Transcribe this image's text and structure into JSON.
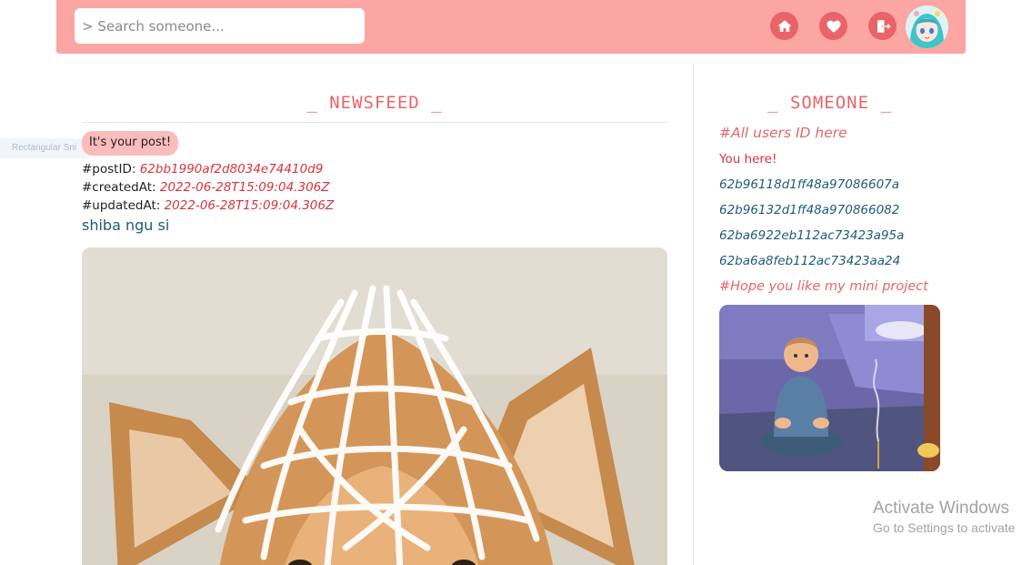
{
  "header": {
    "search_placeholder": "> Search someone...",
    "icons": [
      "home-icon",
      "heart-icon",
      "logout-icon"
    ],
    "accent": "#fba6a3",
    "icon_color": "#e8646a"
  },
  "ghost_tooltip": "Rectangular Sni",
  "newsfeed": {
    "title": "_ NEWSFEED _",
    "post": {
      "badge": "It's your post!",
      "post_id_label": "#postID:",
      "post_id": "62bb1990af2d8034e74410d9",
      "created_label": "#createdAt:",
      "created_at": "2022-06-28T15:09:04.306Z",
      "updated_label": "#updatedAt:",
      "updated_at": "2022-06-28T15:09:04.306Z",
      "caption": "shiba ngu si"
    }
  },
  "someone": {
    "title": "_ SOMEONE _",
    "all_users_label": "#All users ID here",
    "you_here": "You here!",
    "user_ids": [
      "62b96118d1ff48a97086607a",
      "62b96132d1ff48a970866082",
      "62ba6922eb112ac73423a95a",
      "62ba6a8feb112ac73423aa24"
    ],
    "hope_label": "#Hope you like my mini project"
  },
  "os_watermark": {
    "line1": "Activate Windows",
    "line2": "Go to Settings to activate"
  }
}
